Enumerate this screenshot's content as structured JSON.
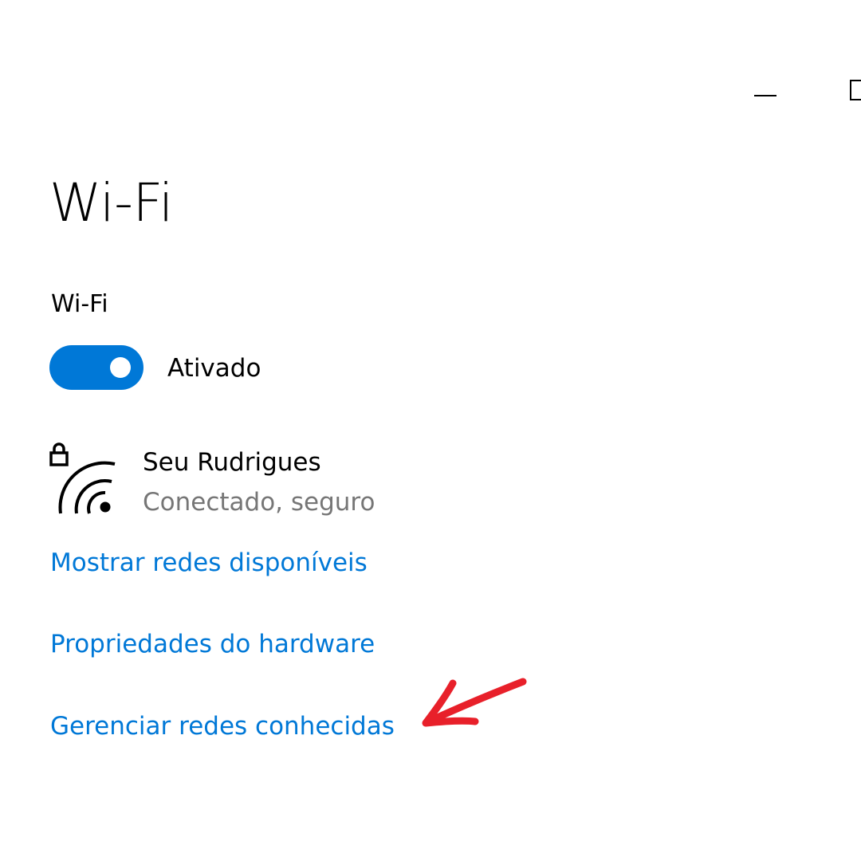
{
  "window": {
    "minimize_icon": "minimize-icon",
    "maximize_icon": "maximize-icon"
  },
  "page": {
    "title": "Wi-Fi"
  },
  "wifi": {
    "section_label": "Wi-Fi",
    "toggle_state": "Ativado",
    "toggle_on": true
  },
  "network": {
    "name": "Seu Rudrigues",
    "status": "Conectado, seguro",
    "icon": "secured-wifi-icon"
  },
  "links": {
    "show_networks": "Mostrar redes disponíveis",
    "hardware_properties": "Propriedades do hardware",
    "manage_known_networks": "Gerenciar redes conhecidas"
  },
  "annotation": {
    "icon": "red-arrow-annotation"
  },
  "colors": {
    "accent": "#0078d7",
    "text_primary": "#000000",
    "text_secondary": "#767676",
    "annotation": "#e8202a"
  }
}
